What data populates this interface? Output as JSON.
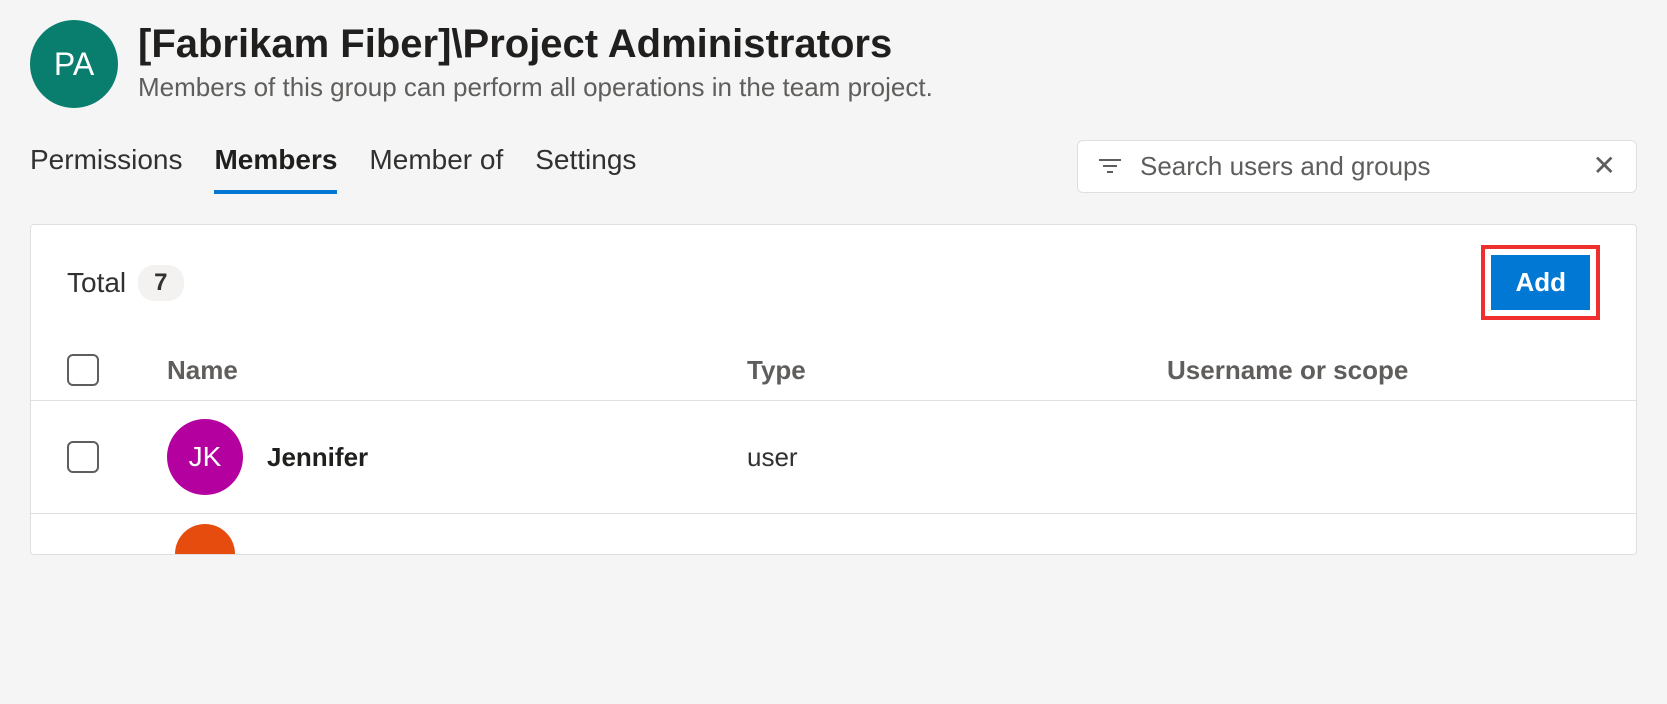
{
  "group": {
    "avatar_initials": "PA",
    "title": "[Fabrikam Fiber]\\Project Administrators",
    "description": "Members of this group can perform all operations in the team project."
  },
  "tabs": {
    "permissions": "Permissions",
    "members": "Members",
    "member_of": "Member of",
    "settings": "Settings",
    "active": "members"
  },
  "search": {
    "placeholder": "Search users and groups"
  },
  "panel": {
    "total_label": "Total",
    "total_count": "7",
    "add_label": "Add"
  },
  "columns": {
    "name": "Name",
    "type": "Type",
    "scope": "Username or scope"
  },
  "members": [
    {
      "initials": "JK",
      "name": "Jennifer",
      "type": "user",
      "scope": "",
      "avatar_color": "#b4009e"
    }
  ]
}
